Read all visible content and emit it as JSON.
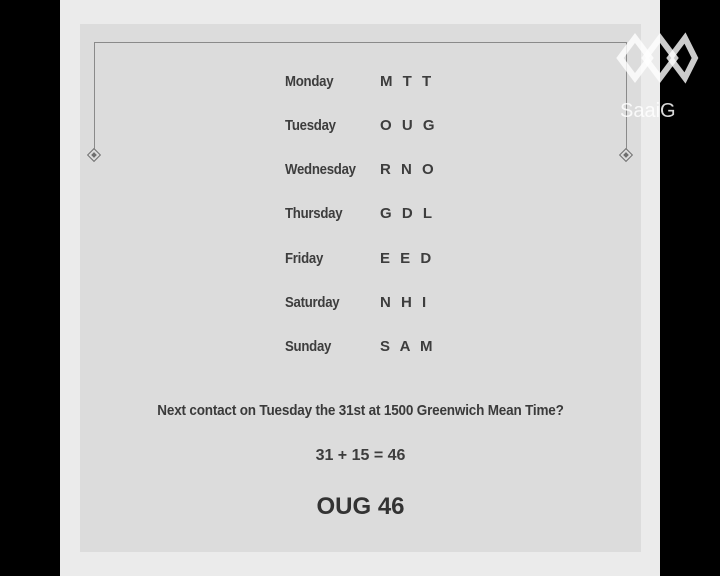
{
  "puzzle": {
    "rows": [
      {
        "day": "Monday",
        "letters": "M T T"
      },
      {
        "day": "Tuesday",
        "letters": "O U G"
      },
      {
        "day": "Wednesday",
        "letters": "R N O"
      },
      {
        "day": "Thursday",
        "letters": "G D L"
      },
      {
        "day": "Friday",
        "letters": "E E D"
      },
      {
        "day": "Saturday",
        "letters": "N H I"
      },
      {
        "day": "Sunday",
        "letters": "S A M"
      }
    ],
    "question": "Next contact on Tuesday the 31st at 1500 Greenwich Mean Time?",
    "equation": "31 + 15 = 46",
    "answer": "OUG 46"
  },
  "watermark": {
    "text": "SaaiG"
  }
}
